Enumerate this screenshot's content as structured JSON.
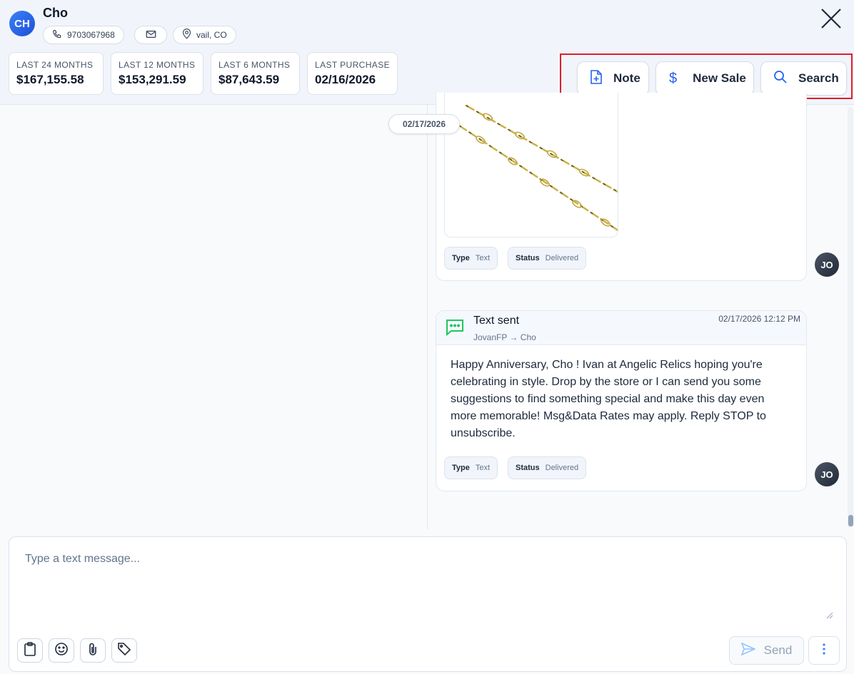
{
  "contact": {
    "initials": "CH",
    "name": "Cho",
    "phone": "9703067968",
    "location": "vail, CO"
  },
  "stats": [
    {
      "label": "LAST 24 MONTHS",
      "value": "$167,155.58"
    },
    {
      "label": "LAST 12 MONTHS",
      "value": "$153,291.59"
    },
    {
      "label": "LAST 6 MONTHS",
      "value": "$87,643.59"
    },
    {
      "label": "LAST PURCHASE",
      "value": "02/16/2026"
    }
  ],
  "actions": {
    "note": "Note",
    "new_sale": "New Sale",
    "search": "Search"
  },
  "thread": {
    "date_pill": "02/17/2026",
    "message1": {
      "type_label": "Type",
      "type_value": "Text",
      "status_label": "Status",
      "status_value": "Delivered",
      "agent_initials": "JO"
    },
    "message2": {
      "title": "Text sent",
      "route": "JovanFP → Cho",
      "timestamp": "02/17/2026 12:12 PM",
      "body": "Happy Anniversary, Cho ! Ivan at Angelic Relics hoping you're celebrating in style. Drop by the store or I can send you some suggestions to find something special and make this day even more memorable! Msg&Data Rates may apply. Reply STOP to unsubscribe.",
      "type_label": "Type",
      "type_value": "Text",
      "status_label": "Status",
      "status_value": "Delivered",
      "agent_initials": "JO"
    }
  },
  "composer": {
    "placeholder": "Type a text message...",
    "send_label": "Send"
  },
  "colors": {
    "accent": "#2563eb",
    "highlight": "#e11d2b",
    "text_sent_icon": "#22c55e"
  }
}
